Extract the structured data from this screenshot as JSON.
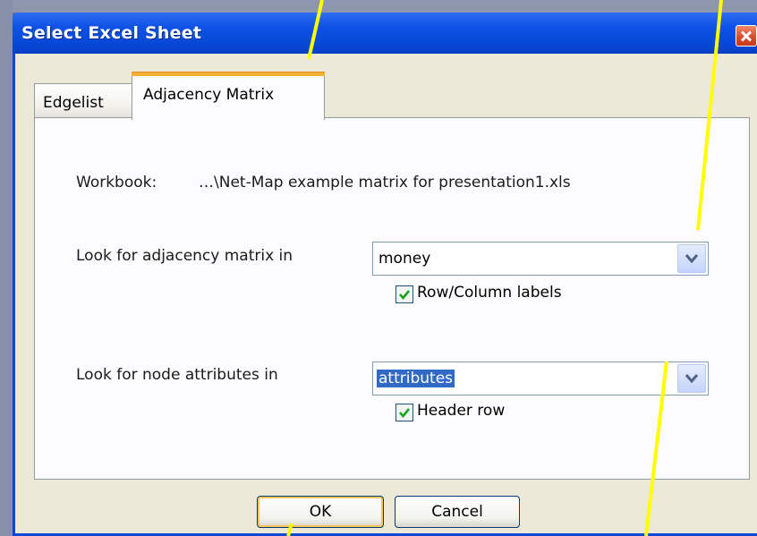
{
  "window": {
    "title": "Select Excel Sheet"
  },
  "tabs": [
    {
      "label": "Edgelist",
      "active": false
    },
    {
      "label": "Adjacency Matrix",
      "active": true
    }
  ],
  "workbook": {
    "label": "Workbook:",
    "value": "…\\Net-Map example matrix for presentation1.xls"
  },
  "adjacency": {
    "label": "Look for adjacency matrix in",
    "selected": "money",
    "checkbox_label": "Row/Column labels",
    "checked": true
  },
  "node_attributes": {
    "label": "Look for node attributes in",
    "selected": "attributes",
    "checkbox_label": "Header row",
    "checked": true
  },
  "buttons": {
    "ok": "OK",
    "cancel": "Cancel"
  },
  "colors": {
    "titlebar": "#0747d6",
    "accent_tab": "#f4b030",
    "selection": "#316ac5",
    "callout": "#ffff00"
  },
  "icons": {
    "close": "close-icon",
    "dropdown": "chevron-down-icon",
    "check": "checkmark-icon"
  }
}
